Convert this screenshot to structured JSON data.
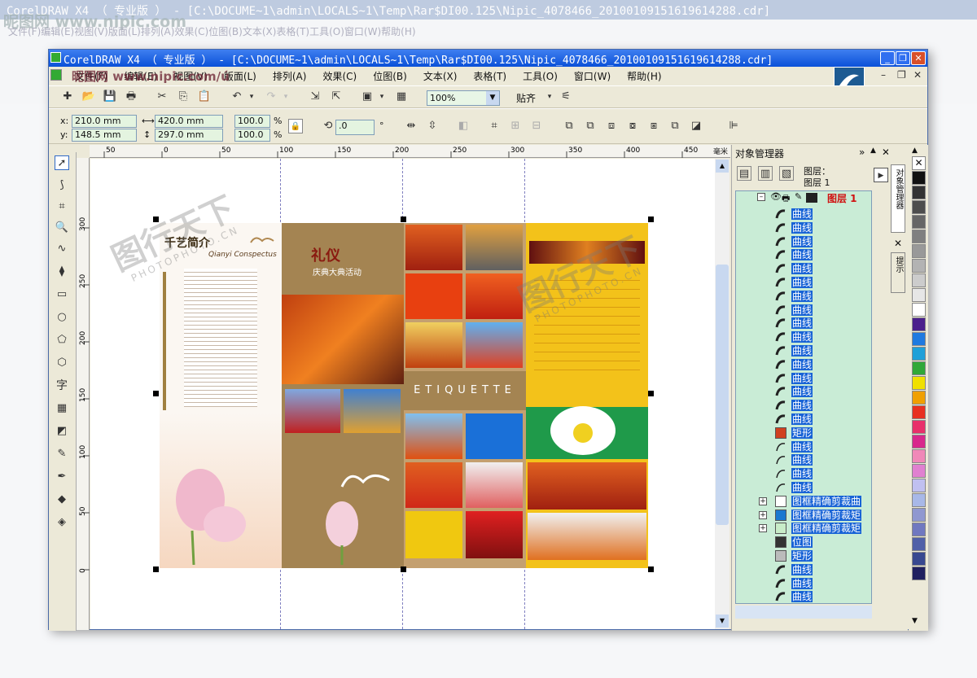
{
  "background_window": {
    "title": "CorelDRAW X4 （ 专业版 ） - [C:\\DOCUME~1\\admin\\LOCALS~1\\Temp\\Rar$DI00.125\\Nipic_4078466_20100109151619614288.cdr]",
    "watermark": "昵图网 www.nipic.com",
    "menu": [
      "文件(F)",
      "编辑(E)",
      "视图(V)",
      "版面(L)",
      "排列(A)",
      "效果(C)",
      "位图(B)",
      "文本(X)",
      "表格(T)",
      "工具(O)",
      "窗口(W)",
      "帮助(H)"
    ]
  },
  "window": {
    "title": "CorelDRAW X4 （ 专业版 ） - [C:\\DOCUME~1\\admin\\LOCALS~1\\Temp\\Rar$DI00.125\\Nipic_4078466_20100109151619614288.cdr]",
    "watermark": "昵图网 www.nipic.com/ú"
  },
  "menu": [
    "文件(F)",
    "编辑(E)",
    "视图(V)",
    "版面(L)",
    "排列(A)",
    "效果(C)",
    "位图(B)",
    "文本(X)",
    "表格(T)",
    "工具(O)",
    "窗口(W)",
    "帮助(H)"
  ],
  "toolbar": {
    "zoom": "100%",
    "snap_label": "贴齐"
  },
  "property_bar": {
    "x": "210.0 mm",
    "y": "148.5 mm",
    "width": "420.0 mm",
    "height": "297.0 mm",
    "scale_x": "100.0",
    "scale_y": "100.0",
    "percent_sign": "%",
    "rotation": ".0",
    "degree_sign": "°"
  },
  "rulers": {
    "top_ticks": [
      "50",
      "0",
      "50",
      "100",
      "150",
      "200",
      "250",
      "300",
      "350",
      "400",
      "450"
    ],
    "top_unit": "毫米",
    "left_ticks": [
      "300",
      "250",
      "200",
      "150",
      "100",
      "50",
      "0"
    ]
  },
  "design": {
    "page1_title": "千艺简介",
    "page1_subtitle": "Qianyi Conspectus",
    "page2_title": "礼仪",
    "page2_subtitle": "庆典大典活动",
    "middle_band": "ETIQUETTE",
    "watermark": "图行天下",
    "watermark_url": "PHOTOPHOTO.CN"
  },
  "object_manager": {
    "title": "对象管理器",
    "layers_label": "图层：",
    "layer_name_top": "图层 1",
    "layer_name": "图层 1",
    "side_tabs": [
      "对象管理器",
      "提示"
    ],
    "items": [
      {
        "icon": "curve",
        "label": "曲线"
      },
      {
        "icon": "curve",
        "label": "曲线"
      },
      {
        "icon": "curve",
        "label": "曲线"
      },
      {
        "icon": "curve",
        "label": "曲线"
      },
      {
        "icon": "curve",
        "label": "曲线"
      },
      {
        "icon": "curve",
        "label": "曲线"
      },
      {
        "icon": "curve",
        "label": "曲线"
      },
      {
        "icon": "curve",
        "label": "曲线"
      },
      {
        "icon": "curve",
        "label": "曲线"
      },
      {
        "icon": "curve",
        "label": "曲线"
      },
      {
        "icon": "curve",
        "label": "曲线"
      },
      {
        "icon": "curve",
        "label": "曲线"
      },
      {
        "icon": "curve",
        "label": "曲线"
      },
      {
        "icon": "curve",
        "label": "曲线"
      },
      {
        "icon": "curve",
        "label": "曲线"
      },
      {
        "icon": "curve",
        "label": "曲线"
      },
      {
        "icon": "rect",
        "label": "矩形",
        "color": "#d04020"
      },
      {
        "icon": "curve-outline",
        "label": "曲线"
      },
      {
        "icon": "curve-outline",
        "label": "曲线"
      },
      {
        "icon": "curve-outline",
        "label": "曲线"
      },
      {
        "icon": "curve-outline",
        "label": "曲线"
      },
      {
        "icon": "powerclip",
        "label": "图框精确剪裁曲",
        "color": "#ffffff"
      },
      {
        "icon": "powerclip",
        "label": "图框精确剪裁矩",
        "color": "#1a78d0"
      },
      {
        "icon": "powerclip",
        "label": "图框精确剪裁矩",
        "color": "#c8ecc8"
      },
      {
        "icon": "bitmap",
        "label": "位图"
      },
      {
        "icon": "rect",
        "label": "矩形",
        "color": "#bbbbbb"
      },
      {
        "icon": "curve",
        "label": "曲线"
      },
      {
        "icon": "curve",
        "label": "曲线"
      },
      {
        "icon": "curve",
        "label": "曲线"
      },
      {
        "icon": "curve",
        "label": "曲线"
      }
    ]
  },
  "palette": [
    "#ffffff",
    "#111111",
    "#333333",
    "#4d4d4d",
    "#666666",
    "#808080",
    "#999999",
    "#b3b3b3",
    "#cccccc",
    "#e6e6e6",
    "#ffffff",
    "#4b1f8c",
    "#1f7ae0",
    "#1fa0d8",
    "#30a838",
    "#f0e000",
    "#f0a000",
    "#e83020",
    "#e8306a",
    "#d8288c",
    "#f088b8",
    "#e080d0",
    "#c0c0f0",
    "#a8b8e8",
    "#9098d0",
    "#7078c0",
    "#5060a8",
    "#384890",
    "#202060"
  ]
}
